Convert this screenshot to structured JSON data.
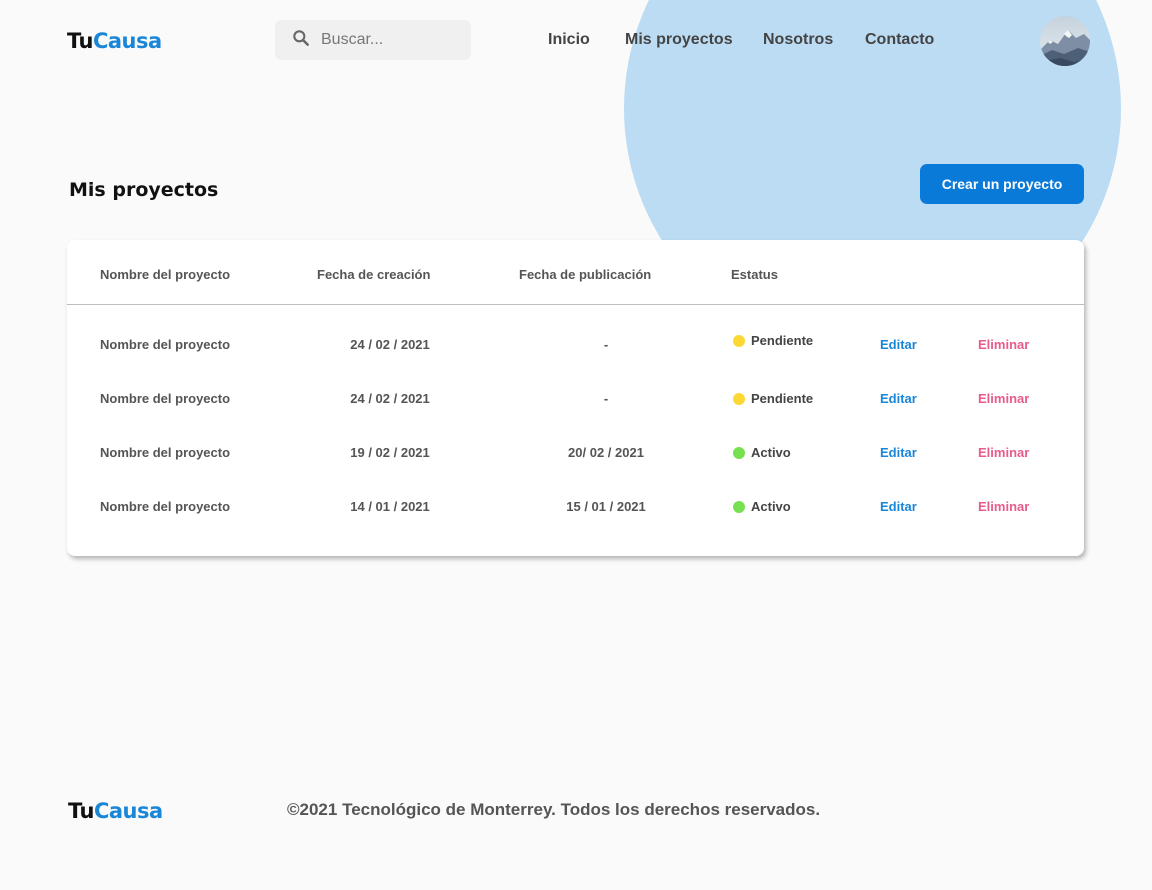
{
  "brand": {
    "part1": "Tu",
    "part2": "Causa"
  },
  "search": {
    "placeholder": "Buscar...",
    "icon": "search-icon"
  },
  "nav": {
    "items": [
      {
        "label": "Inicio"
      },
      {
        "label": "Mis proyectos"
      },
      {
        "label": "Nosotros"
      },
      {
        "label": "Contacto"
      }
    ]
  },
  "main": {
    "title": "Mis proyectos",
    "create_button": "Crear un proyecto"
  },
  "table": {
    "headers": [
      "Nombre del proyecto",
      "Fecha de creación",
      "Fecha de publicación",
      "Estatus"
    ],
    "rows": [
      {
        "name": "Nombre del proyecto",
        "created": "24 / 02 / 2021",
        "published": "-",
        "status": "Pendiente",
        "status_color": "#fdd835",
        "edit": "Editar",
        "delete": "Eliminar"
      },
      {
        "name": "Nombre del proyecto",
        "created": "24 / 02 / 2021",
        "published": "-",
        "status": "Pendiente",
        "status_color": "#fdd835",
        "edit": "Editar",
        "delete": "Eliminar"
      },
      {
        "name": "Nombre del proyecto",
        "created": "19 / 02 / 2021",
        "published": "20/ 02 / 2021",
        "status": "Activo",
        "status_color": "#76e050",
        "edit": "Editar",
        "delete": "Eliminar"
      },
      {
        "name": "Nombre del proyecto",
        "created": "14 / 01 / 2021",
        "published": "15 / 01 / 2021",
        "status": "Activo",
        "status_color": "#76e050",
        "edit": "Editar",
        "delete": "Eliminar"
      }
    ]
  },
  "footer": {
    "copyright": "©2021 Tecnológico de Monterrey. Todos los derechos reservados."
  },
  "colors": {
    "accent": "#0a7ad9",
    "brand_blue": "#1a86d8",
    "delete": "#e85b8a",
    "background_circle": "#bcdcf4"
  }
}
